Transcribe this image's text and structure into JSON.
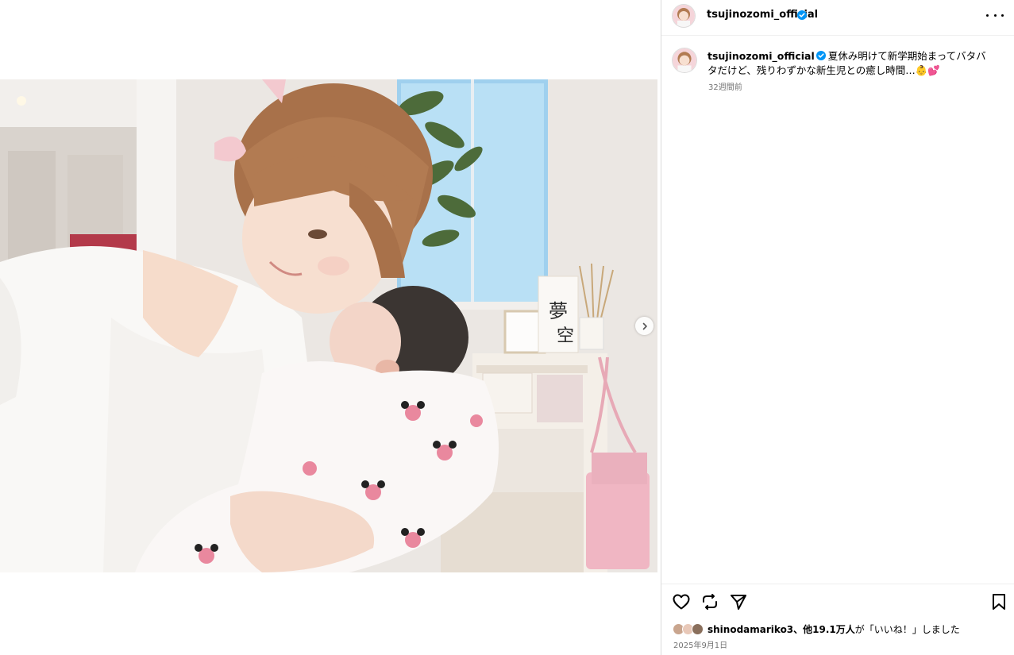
{
  "post": {
    "photo_alt": "",
    "carousel_next_icon": "chevron-right-icon"
  },
  "header": {
    "username": "tsujinozomi_official",
    "verified": true,
    "more_icon": "more-horizontal-icon"
  },
  "caption": {
    "username": "tsujinozomi_official",
    "text": "夏休み明けて新学期始まってバタバタだけど、残りわずかな新生児との癒し時間…",
    "emoji": "👶💕",
    "time_ago": "32週間前"
  },
  "actions": {
    "like_icon": "heart-icon",
    "comment_icon": "comment-icon",
    "share_icon": "send-icon",
    "save_icon": "bookmark-icon"
  },
  "likes": {
    "first_user": "shinodamariko3",
    "rest": "、他19.1万人",
    "suffix": "が「いいね！」しました"
  },
  "date": "2025年9月1日",
  "colors": {
    "verified": "#0095f6",
    "border": "#dbdbdb",
    "muted": "#737373"
  }
}
